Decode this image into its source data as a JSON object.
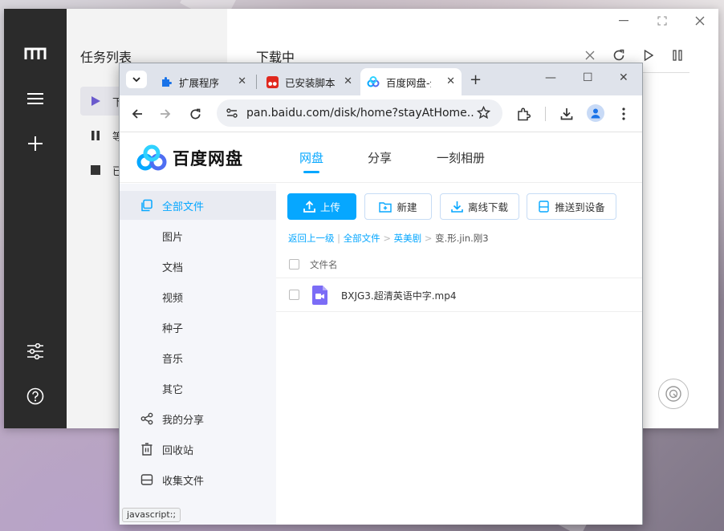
{
  "downloader": {
    "panel_title": "任务列表",
    "tasks": [
      {
        "label": "下载中"
      },
      {
        "label": "等待中"
      },
      {
        "label": "已停止"
      }
    ],
    "main_title": "下载中"
  },
  "browser": {
    "tabs": [
      {
        "label": "扩展程序",
        "icon": "puzzle-icon"
      },
      {
        "label": "已安装脚本",
        "icon": "tampermonkey-icon"
      },
      {
        "label": "百度网盘-全",
        "icon": "baidu-netdisk-icon"
      }
    ],
    "url": "pan.baidu.com/disk/home?stayAtHome...",
    "status_text": "javascript:;"
  },
  "page": {
    "logo_text": "百度网盘",
    "nav": [
      {
        "label": "网盘"
      },
      {
        "label": "分享"
      },
      {
        "label": "一刻相册"
      }
    ],
    "sidebar": [
      {
        "label": "全部文件",
        "icon": "folder-icon"
      },
      {
        "label": "图片"
      },
      {
        "label": "文档"
      },
      {
        "label": "视频"
      },
      {
        "label": "种子"
      },
      {
        "label": "音乐"
      },
      {
        "label": "其它"
      },
      {
        "label": "我的分享",
        "icon": "share-icon"
      },
      {
        "label": "回收站",
        "icon": "trash-icon"
      },
      {
        "label": "收集文件",
        "icon": "collect-icon"
      }
    ],
    "toolbar": {
      "upload": "上传",
      "new": "新建",
      "offline": "离线下载",
      "push": "推送到设备"
    },
    "breadcrumb": {
      "back": "返回上一级",
      "sep1": "|",
      "all": "全部文件",
      "arrow1": ">",
      "folder": "英美剧",
      "arrow2": ">",
      "current": "变.形.jin.刚3"
    },
    "table": {
      "header": "文件名",
      "rows": [
        {
          "name": "BXJG3.超清英语中字.mp4",
          "icon": "video-file-icon"
        }
      ]
    }
  },
  "colors": {
    "accent": "#06a7ff",
    "rail": "#2b2b2b"
  }
}
